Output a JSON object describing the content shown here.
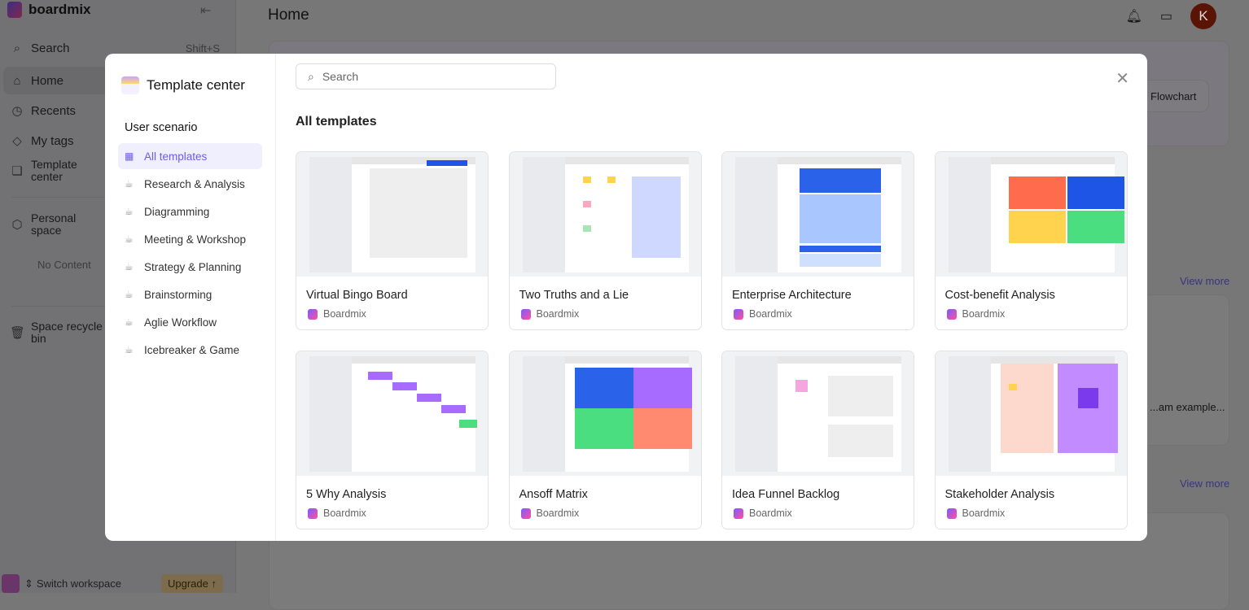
{
  "app": {
    "name": "boardmix"
  },
  "sidebar": {
    "search_label": "Search",
    "search_shortcut": "Shift+S",
    "items": [
      {
        "label": "Home",
        "icon": "home-icon"
      },
      {
        "label": "Recents",
        "icon": "clock-icon"
      },
      {
        "label": "My tags",
        "icon": "tag-icon"
      },
      {
        "label": "Template center",
        "icon": "template-icon"
      }
    ],
    "personal_space": "Personal space",
    "no_content": "No Content",
    "recycle": "Space recycle bin",
    "switch_workspace": "Switch workspace",
    "upgrade": "Upgrade"
  },
  "header": {
    "title": "Home",
    "avatar_initial": "K"
  },
  "background": {
    "flowchart_label": "Flowchart",
    "view_more": "View more",
    "diagram_example": "...am example..."
  },
  "modal": {
    "title": "Template center",
    "section": "User scenario",
    "categories": [
      "All templates",
      "Research & Analysis",
      "Diagramming",
      "Meeting & Workshop",
      "Strategy & Planning",
      "Brainstorming",
      "Aglie Workflow",
      "Icebreaker & Game"
    ],
    "selected_category": "All templates",
    "search_placeholder": "Search",
    "heading": "All templates",
    "templates": [
      {
        "name": "Virtual Bingo Board",
        "author": "Boardmix"
      },
      {
        "name": "Two Truths and a Lie",
        "author": "Boardmix"
      },
      {
        "name": "Enterprise Architecture",
        "author": "Boardmix"
      },
      {
        "name": "Cost-benefit Analysis",
        "author": "Boardmix"
      },
      {
        "name": "5 Why Analysis",
        "author": "Boardmix"
      },
      {
        "name": "Ansoff Matrix",
        "author": "Boardmix"
      },
      {
        "name": "Idea Funnel Backlog",
        "author": "Boardmix"
      },
      {
        "name": "Stakeholder Analysis",
        "author": "Boardmix"
      }
    ]
  },
  "colors": {
    "accent": "#6a5cf0",
    "avatar": "#a1260a"
  }
}
